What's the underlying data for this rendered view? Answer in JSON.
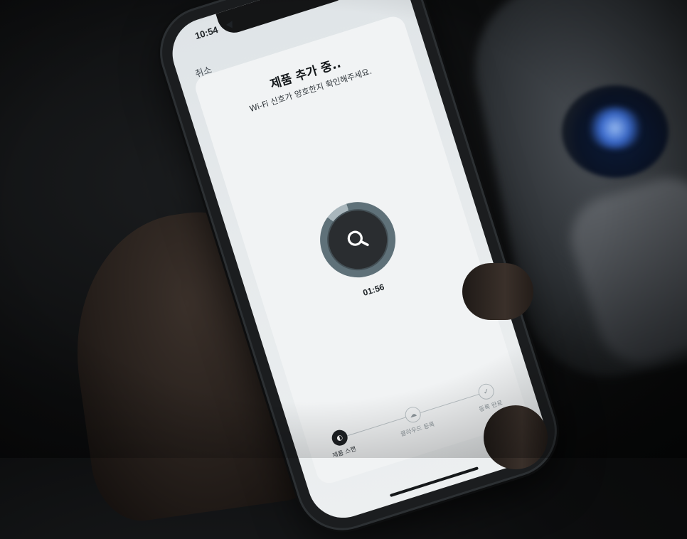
{
  "status_bar": {
    "time": "10:54",
    "location_icon": "location-arrow-icon"
  },
  "header": {
    "cancel_label": "취소"
  },
  "main": {
    "title": "제품 추가 중..",
    "subtitle": "Wi-Fi 신호가 양호한지 확인해주세요.",
    "scan_icon": "search-icon",
    "progress": 0.9,
    "timer": "01:56"
  },
  "steps": [
    {
      "label": "제품 스캔",
      "icon": "scan-icon",
      "active": true
    },
    {
      "label": "클라우드 등록",
      "icon": "cloud-icon",
      "active": false
    },
    {
      "label": "등록 완료",
      "icon": "check-icon",
      "active": false
    }
  ],
  "colors": {
    "ring": "#5f7179",
    "ring_remaining": "#a9b6bc",
    "scan_center": "#2a2d30"
  }
}
